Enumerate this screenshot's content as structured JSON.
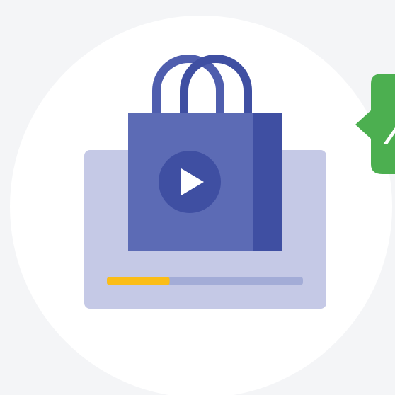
{
  "illustration": {
    "subject": "shopping-bag-video-player",
    "icons": [
      "shopping-bag-icon",
      "play-icon",
      "badge-tag-icon"
    ],
    "progress_fraction": 0.32,
    "colors": {
      "page_background": "#f4f5f7",
      "circle_background": "#ffffff",
      "player_panel": "#c5c9e6",
      "progress_track": "#a3acd7",
      "progress_fill": "#fbbd17",
      "bag_front": "#5c6bb5",
      "bag_side": "#3f4fa2",
      "bag_handle_back": "#4f5eae",
      "bag_handle_front": "#3f4fa2",
      "play_button_bg": "#3f4fa2",
      "play_triangle": "#ffffff",
      "badge": "#4caf50",
      "badge_mark": "#ffffff"
    }
  }
}
